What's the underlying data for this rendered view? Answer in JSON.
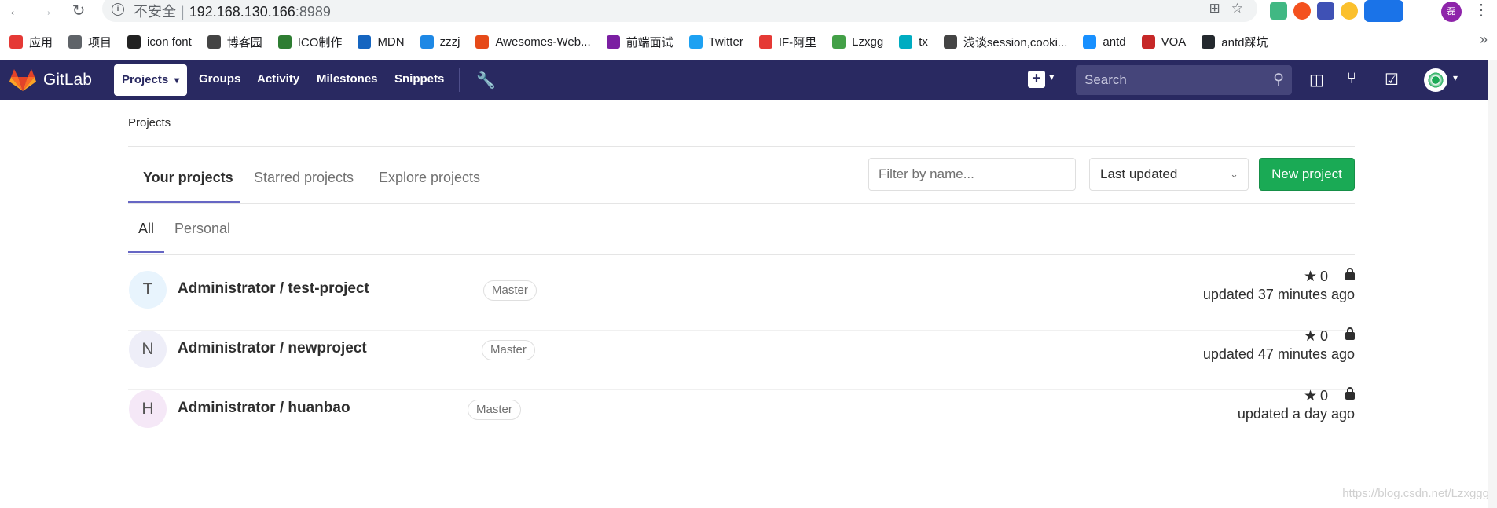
{
  "browser": {
    "url_prefix": "不安全",
    "url_host": "192.168.130.166",
    "url_port": ":8989",
    "bookmarks": [
      {
        "label": "应用",
        "color": "#e53935"
      },
      {
        "label": "项目",
        "color": "#5f6368"
      },
      {
        "label": "icon font",
        "color": "#222222"
      },
      {
        "label": "博客园",
        "color": "#444444"
      },
      {
        "label": "ICO制作",
        "color": "#2e7d32"
      },
      {
        "label": "MDN",
        "color": "#1565c0"
      },
      {
        "label": "zzzj",
        "color": "#1e88e5"
      },
      {
        "label": "Awesomes-Web...",
        "color": "#e64a19"
      },
      {
        "label": "前端面试",
        "color": "#7b1fa2"
      },
      {
        "label": "Twitter",
        "color": "#1da1f2"
      },
      {
        "label": "IF-阿里",
        "color": "#e53935"
      },
      {
        "label": "Lzxgg",
        "color": "#43a047"
      },
      {
        "label": "tx",
        "color": "#00acc1"
      },
      {
        "label": "浅谈session,cooki...",
        "color": "#444444"
      },
      {
        "label": "antd",
        "color": "#1890ff"
      },
      {
        "label": "VOA",
        "color": "#c62828"
      },
      {
        "label": "antd踩坑",
        "color": "#24292e"
      }
    ]
  },
  "nav": {
    "brand": "GitLab",
    "projects": "Projects",
    "links": [
      "Groups",
      "Activity",
      "Milestones",
      "Snippets"
    ],
    "search_placeholder": "Search"
  },
  "page": {
    "breadcrumb": "Projects",
    "tabs": [
      "Your projects",
      "Starred projects",
      "Explore projects"
    ],
    "subtabs": [
      "All",
      "Personal"
    ],
    "filter_placeholder": "Filter by name...",
    "sort_label": "Last updated",
    "new_project": "New project"
  },
  "projects": [
    {
      "initial": "T",
      "name": "Administrator / test-project",
      "badge": "Master",
      "stars": "0",
      "updated": "updated 37 minutes ago",
      "avatar_color": "#e8f4fd"
    },
    {
      "initial": "N",
      "name": "Administrator / newproject",
      "badge": "Master",
      "stars": "0",
      "updated": "updated 47 minutes ago",
      "avatar_color": "#eeeef8"
    },
    {
      "initial": "H",
      "name": "Administrator / huanbao",
      "badge": "Master",
      "stars": "0",
      "updated": "updated a day ago",
      "avatar_color": "#f5e8f7"
    }
  ],
  "watermark": "https://blog.csdn.net/Lzxggg"
}
